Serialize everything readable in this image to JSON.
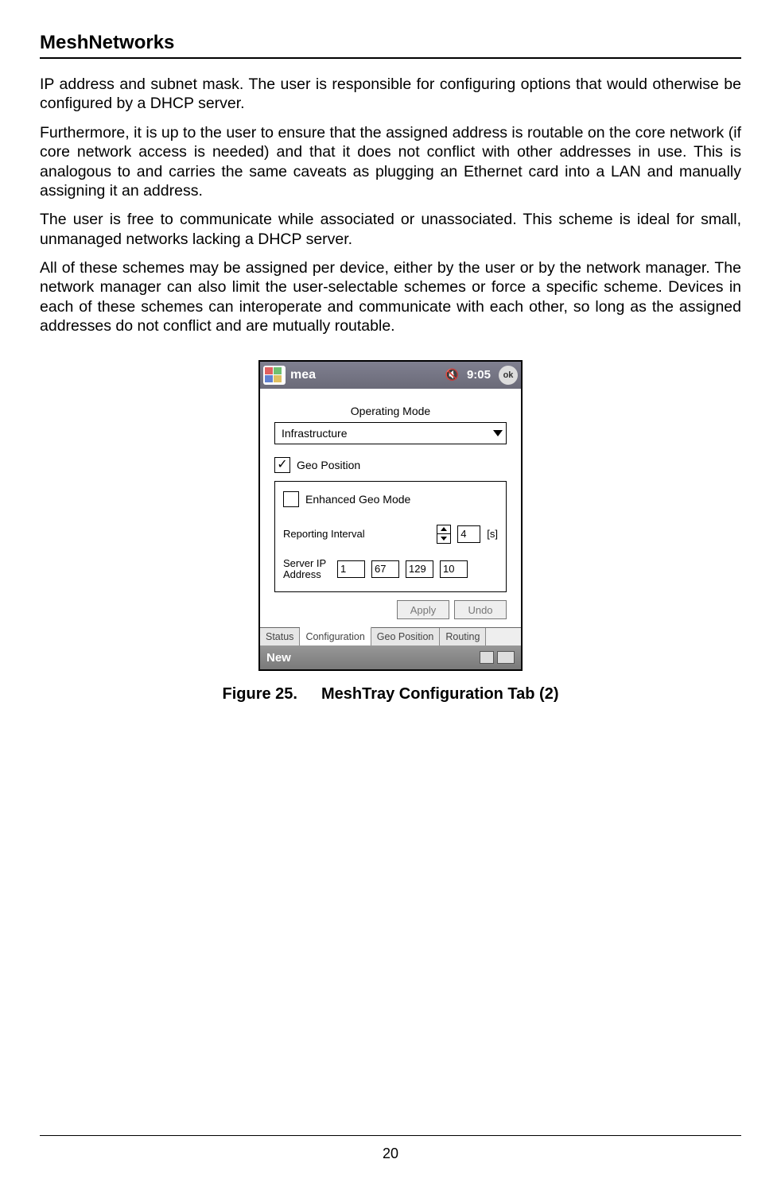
{
  "header": {
    "title": "MeshNetworks"
  },
  "paragraphs": {
    "p1": "IP address and subnet mask.  The user is responsible for configuring options that would otherwise be configured by a DHCP server.",
    "p2": "Furthermore, it is up to the user to ensure that the assigned address is routable on the core network (if core network access is needed) and that it does not conflict with other addresses in use.  This is analogous to and carries the same caveats as plugging an Ethernet card into a LAN and manually assigning it an address.",
    "p3": "The user is free to communicate while associated or unassociated. This scheme is ideal for small, unmanaged networks lacking a DHCP server.",
    "p4": "All of these schemes may be assigned per device, either by the user or by the network manager.  The network manager can also limit the user-selectable schemes or force a specific scheme.  Devices in each of these schemes can interoperate and communicate with each other, so long as the assigned addresses do not conflict and are mutually routable."
  },
  "screenshot": {
    "title_bar": {
      "app": "mea",
      "clock": "9:05",
      "ok": "ok"
    },
    "operating_mode": {
      "label": "Operating Mode",
      "value": "Infrastructure"
    },
    "geo_position": {
      "checked": true,
      "label": "Geo Position"
    },
    "enhanced": {
      "checked": false,
      "label": "Enhanced Geo Mode"
    },
    "reporting": {
      "label": "Reporting Interval",
      "value": "4",
      "unit": "[s]"
    },
    "server_ip": {
      "label": "Server IP\nAddress",
      "a": "1",
      "b": "67",
      "c": "129",
      "d": "10"
    },
    "buttons": {
      "apply": "Apply",
      "undo": "Undo"
    },
    "tabs": {
      "t1": "Status",
      "t2": "Configuration",
      "t3": "Geo Position",
      "t4": "Routing"
    },
    "bottom": {
      "new": "New"
    }
  },
  "figure": {
    "num": "Figure 25.",
    "caption": "MeshTray Configuration Tab (2)"
  },
  "page_number": "20"
}
